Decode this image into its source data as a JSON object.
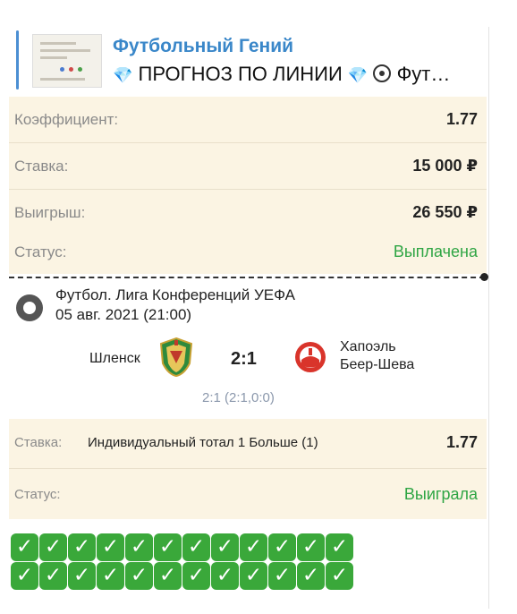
{
  "quote": {
    "title": "Футбольный Гений",
    "subtitle_text": "ПРОГНОЗ ПО ЛИНИИ",
    "subtitle_tail": "Фут…",
    "gem_icon": "💎"
  },
  "coupon": {
    "rows": [
      {
        "label": "Коэффициент:",
        "value": "1.77"
      },
      {
        "label": "Ставка:",
        "value": "15 000 ₽"
      },
      {
        "label": "Выигрыш:",
        "value": "26 550 ₽"
      },
      {
        "label": "Статус:",
        "value": "Выплачена",
        "value_color": "#2fa544"
      }
    ]
  },
  "event": {
    "league": "Футбол. Лига Конференций УЕФА",
    "date": "05 авг. 2021 (21:00)",
    "home_team": "Шленск",
    "away_team_line1": "Хапоэль",
    "away_team_line2": "Беер-Шева",
    "score": "2:1",
    "halves": "2:1 (2:1,0:0)"
  },
  "bet": {
    "label": "Ставка:",
    "description": "Индивидуальный тотал 1 Больше (1)",
    "odds": "1.77",
    "status_label": "Статус:",
    "status_value": "Выиграла"
  },
  "checks": {
    "icon": "✓",
    "rows": [
      12,
      12
    ],
    "color": "#3aa83a"
  }
}
